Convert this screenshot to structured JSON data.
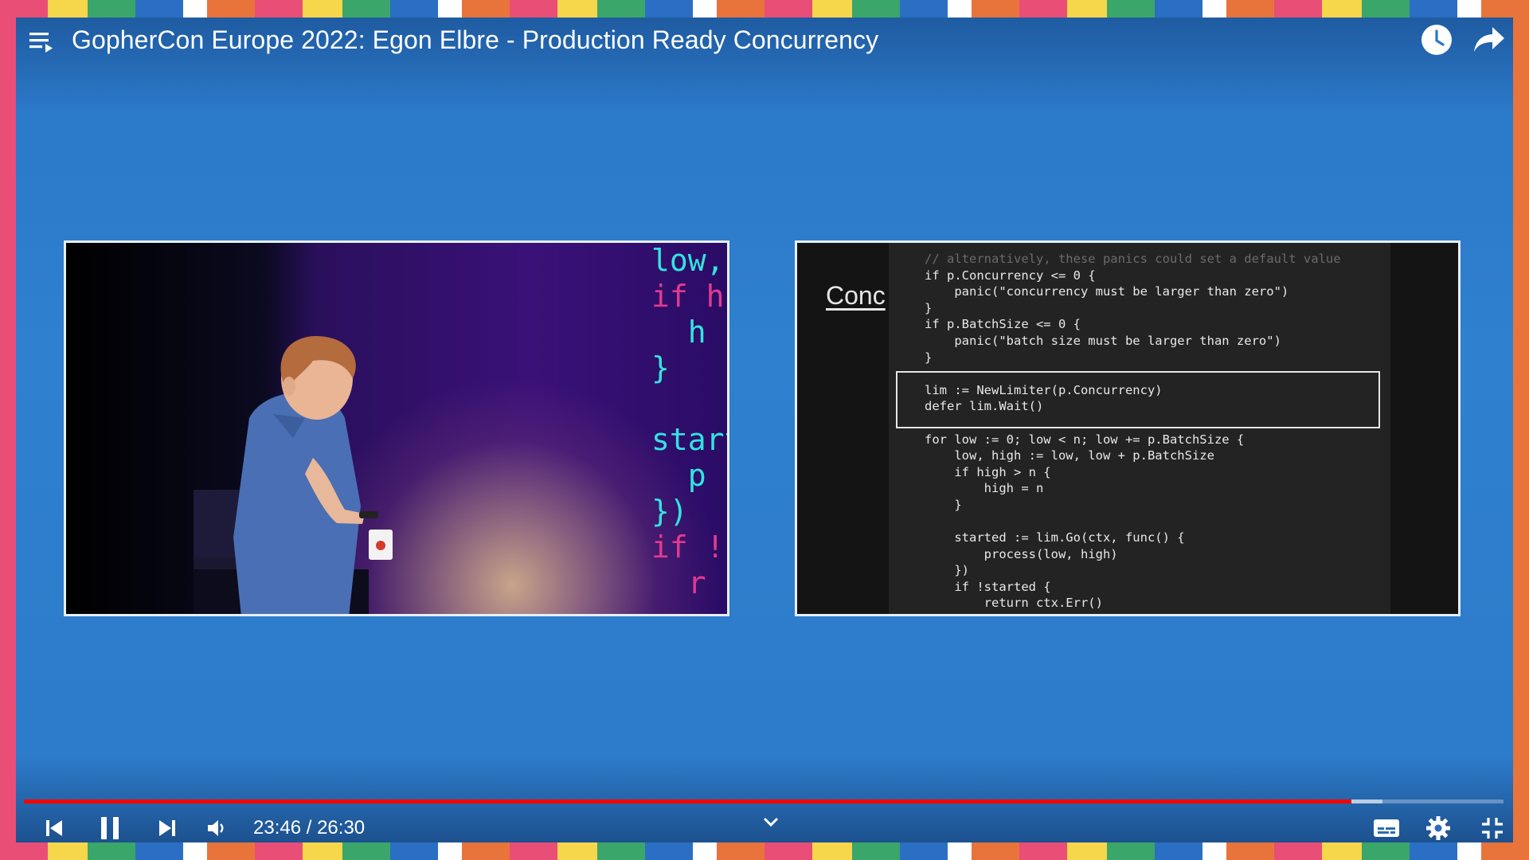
{
  "video": {
    "title": "GopherCon Europe 2022: Egon Elbre - Production Ready Concurrency",
    "current_time": "23:46",
    "separator": "/",
    "duration": "26:30",
    "progress_fraction": 0.897,
    "buffered_fraction": 0.918
  },
  "icons": {
    "playlist": "playlist-icon",
    "watch_later": "clock-icon",
    "share": "share-icon",
    "previous": "skip-previous-icon",
    "pause": "pause-icon",
    "next": "skip-next-icon",
    "volume": "volume-icon",
    "chevron": "chevron-down-icon",
    "subtitles": "subtitles-icon",
    "settings": "gear-icon",
    "exit_fullscreen": "exit-fullscreen-icon"
  },
  "stage_screen": {
    "lines": [
      "low,",
      "if h",
      "  h",
      "}",
      "",
      "start",
      "  p",
      "})",
      "if !s",
      "  r"
    ]
  },
  "slide": {
    "title": "Conc",
    "code_lines": [
      "// alternatively, these panics could set a default value",
      "if p.Concurrency <= 0 {",
      "    panic(\"concurrency must be larger than zero\")",
      "}",
      "if p.BatchSize <= 0 {",
      "    panic(\"batch size must be larger than zero\")",
      "}",
      "",
      "lim := NewLimiter(p.Concurrency)",
      "defer lim.Wait()",
      "",
      "for low := 0; low < n; low += p.BatchSize {",
      "    low, high := low, low + p.BatchSize",
      "    if high > n {",
      "        high = n",
      "    }",
      "",
      "    started := lim.Go(ctx, func() {",
      "        process(low, high)",
      "    })",
      "    if !started {",
      "        return ctx.Err()"
    ]
  },
  "colors": {
    "progress_played": "#ff0000",
    "player_bg": "#2f80cf",
    "stage_text": "#34e3df",
    "stage_keyword": "#e23a8f"
  }
}
